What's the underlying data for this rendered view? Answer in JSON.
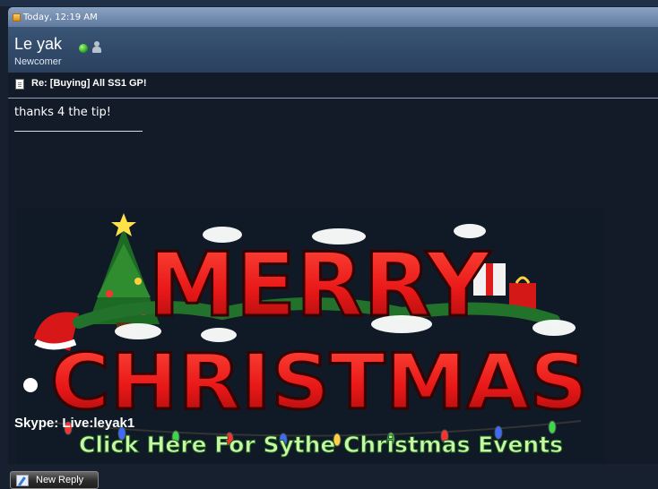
{
  "post": {
    "date": "Today, 12:19 AM",
    "title": "Re: [Buying] All SS1 GP!",
    "message": "thanks 4 the tip!"
  },
  "user": {
    "name": "Le yak",
    "title": "Newcomer",
    "status": "online"
  },
  "signature": {
    "banner": {
      "line1": "MERRY",
      "line2": "CHRISTMAS",
      "link": "Click Here For Sythe Christmas Events"
    },
    "skype": "Skype: Live:leyak1"
  },
  "actions": {
    "new_reply": "New Reply"
  },
  "colors": {
    "header": "#7891b4",
    "user_bar": "#304a6a",
    "background": "#121b27",
    "banner_red": "#e81818",
    "banner_link_green": "#c6f7a4"
  }
}
